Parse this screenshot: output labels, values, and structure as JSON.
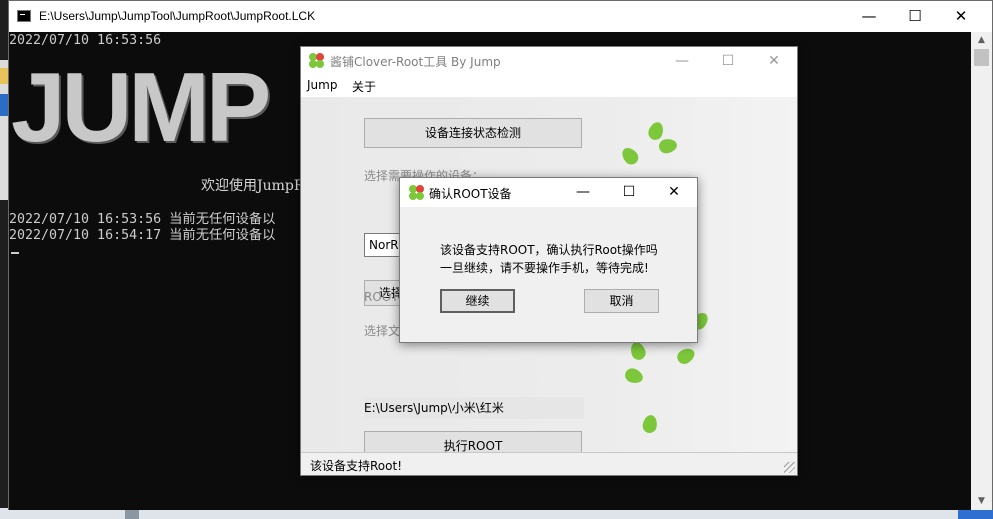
{
  "console": {
    "title": "E:\\Users\\Jump\\JumpTool\\JumpRoot\\JumpRoot.LCK",
    "timestamp_line": "2022/07/10 16:53:56",
    "banner": "JUMP",
    "welcome": "欢迎使用JumpR",
    "log_lines": [
      "2022/07/10 16:53:56 当前无任何设备以",
      "2022/07/10 16:54:17 当前无任何设备以"
    ],
    "controls": {
      "minimize": "—",
      "maximize": "☐",
      "close": "✕"
    }
  },
  "app": {
    "title": "酱铺Clover-Root工具 By Jump",
    "menu": [
      "Jump",
      "关于"
    ],
    "buttons": {
      "check_connection": "设备连接状态检测",
      "select_partial": "选择",
      "execute_root": "执行ROOT"
    },
    "labels": {
      "select_device": "选择需要操作的设备：",
      "root_label": "ROOT",
      "select_file": "选择文"
    },
    "device_combo_value": "NorR",
    "path_value": "E:\\Users\\Jump\\小米\\红米",
    "status": "该设备支持Root!",
    "controls": {
      "minimize": "—",
      "maximize": "☐",
      "close": "✕"
    }
  },
  "dialog": {
    "title": "确认ROOT设备",
    "message_line1": "该设备支持ROOT，确认执行Root操作吗",
    "message_line2": "一旦继续，请不要操作手机，等待完成!",
    "continue_label": "继续",
    "cancel_label": "取消",
    "controls": {
      "minimize": "—",
      "maximize": "☐",
      "close": "✕"
    }
  },
  "colors": {
    "console_bg": "#0c0c0c",
    "console_text": "#cccccc",
    "clover_green": "#7cc83a",
    "clover_red": "#e0443a"
  }
}
